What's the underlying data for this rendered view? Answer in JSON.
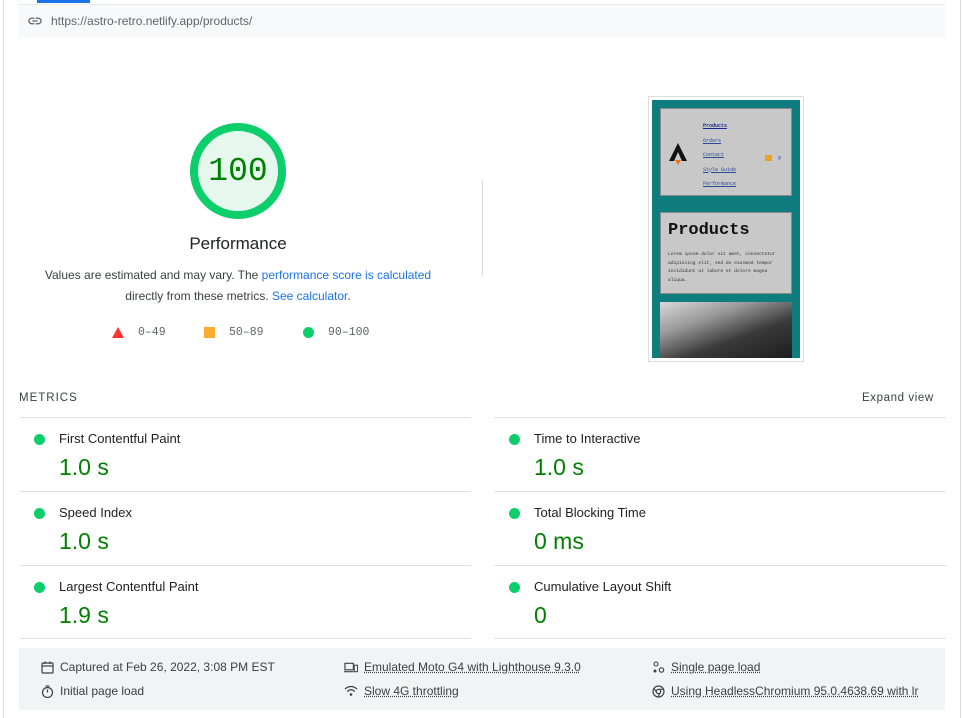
{
  "url": "https://astro-retro.netlify.app/products/",
  "gauge": {
    "score": "100",
    "score_fraction": 1.0,
    "title": "Performance",
    "desc_prefix": "Values are estimated and may vary. The ",
    "desc_link1": "performance score is calculated",
    "desc_middle": "directly from these metrics. ",
    "desc_link2": "See calculator",
    "desc_suffix": "."
  },
  "legend": {
    "fail": "0–49",
    "average": "50–89",
    "pass": "90–100"
  },
  "thumbnail": {
    "nav_links": [
      "Products",
      "Orders",
      "Contact",
      "Style Guide",
      "Performance"
    ],
    "cart_count": "0",
    "heading": "Products",
    "body_text": "Lorem ipsum dolor sit amet, consectetur adipiscing elit, sed do eiusmod tempor incididunt ut labore et dolore magna aliqua."
  },
  "metrics": {
    "label": "METRICS",
    "expand_label": "Expand view",
    "items": [
      {
        "name": "First Contentful Paint",
        "value": "1.0 s"
      },
      {
        "name": "Time to Interactive",
        "value": "1.0 s"
      },
      {
        "name": "Speed Index",
        "value": "1.0 s"
      },
      {
        "name": "Total Blocking Time",
        "value": "0 ms"
      },
      {
        "name": "Largest Contentful Paint",
        "value": "1.9 s"
      },
      {
        "name": "Cumulative Layout Shift",
        "value": "0"
      }
    ]
  },
  "footer": {
    "captured": "Captured at Feb 26, 2022, 3:08 PM EST",
    "initial_load": "Initial page load",
    "device": "Emulated Moto G4 with Lighthouse 9.3.0",
    "throttling": "Slow 4G throttling",
    "single_load": "Single page load",
    "browser": "Using HeadlessChromium 95.0.4638.69 with lr"
  },
  "colors": {
    "pass": "#0cce6b",
    "pass_text": "#008000",
    "average": "#ffaa33",
    "fail": "#ff3333",
    "link": "#1a73e8"
  }
}
